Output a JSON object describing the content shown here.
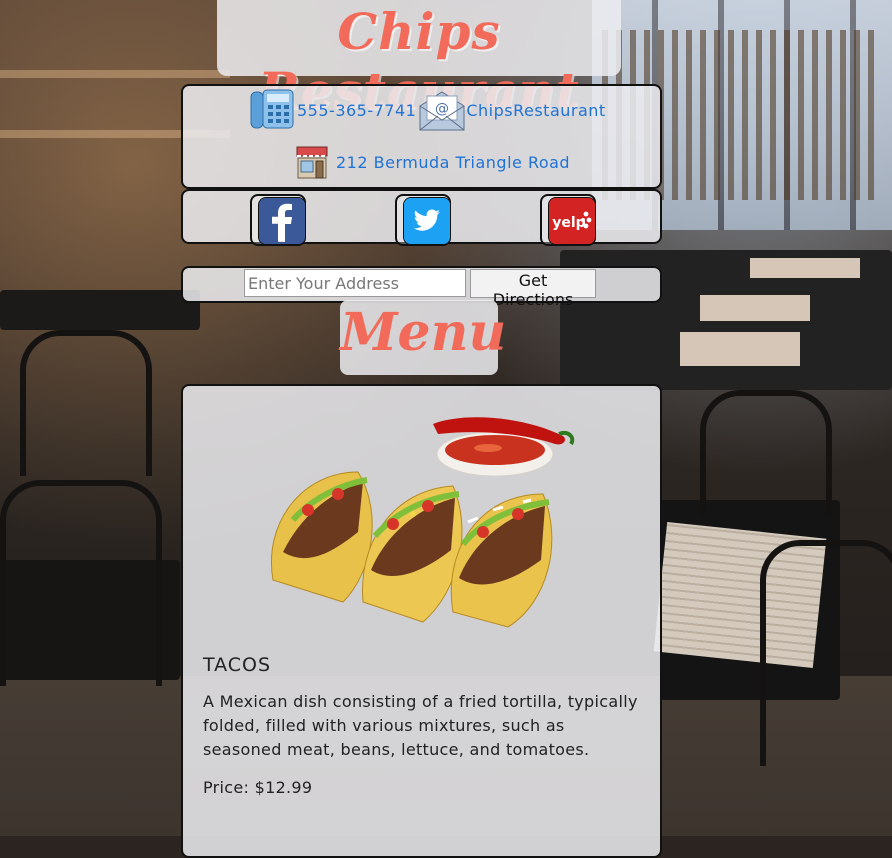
{
  "header": {
    "title": "Chips Restaurant"
  },
  "contact": {
    "phone": "555-365-7741",
    "email": "ChipsRestaurant",
    "address": "212 Bermuda Triangle Road"
  },
  "social": [
    {
      "name": "facebook",
      "glyph": "f",
      "color": "#3b5998"
    },
    {
      "name": "twitter",
      "color": "#1da1f2"
    },
    {
      "name": "yelp",
      "glyph": "yelp",
      "color": "#d32323"
    }
  ],
  "directions": {
    "placeholder": "Enter Your Address",
    "button_label": "Get Directions"
  },
  "menu": {
    "title": "Menu",
    "items": [
      {
        "name": "TACOS",
        "description": "A Mexican dish consisting of a fried tortilla, typically folded, filled with various mixtures, such as seasoned meat, beans, lettuce, and tomatoes.",
        "price": "Price: $12.99"
      }
    ]
  },
  "colors": {
    "accent": "#f26b5a",
    "link": "#1f73d6"
  }
}
